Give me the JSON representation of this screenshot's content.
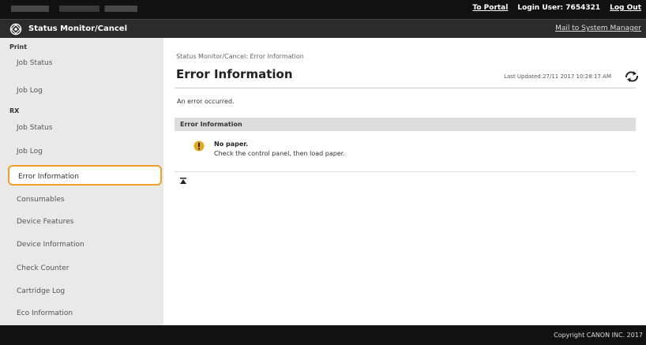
{
  "header": {
    "portal_link": "To Portal",
    "login_user_label": "Login User:",
    "login_user_value": "7654321",
    "logout_link": "Log Out"
  },
  "titlebar": {
    "title": "Status Monitor/Cancel",
    "mail_link": "Mail to System Manager"
  },
  "sidebar": {
    "print_heading": "Print",
    "print_items": [
      "Job Status",
      "Job Log"
    ],
    "rx_heading": "RX",
    "rx_items": [
      "Job Status",
      "Job Log"
    ],
    "items": [
      "Error Information",
      "Consumables",
      "Device Features",
      "Device Information",
      "Check Counter",
      "Cartridge Log",
      "Eco Information"
    ],
    "active_item": "Error Information"
  },
  "main": {
    "breadcrumb": "Status Monitor/Cancel: Error Information",
    "title": "Error Information",
    "last_updated": "Last Updated:27/11 2017 10:28:17 AM",
    "message": "An error occurred.",
    "section_title": "Error Information",
    "error_title": "No paper.",
    "error_description": "Check the control panel, then load paper."
  },
  "footer": {
    "copyright": "Copyright CANON INC. 2017"
  },
  "colors": {
    "accent_highlight": "#f0a02a",
    "warning_icon": "#e6a817",
    "topbar": "#111111",
    "titlebar": "#2b2b2b",
    "sidebar": "#e9e9e9"
  }
}
